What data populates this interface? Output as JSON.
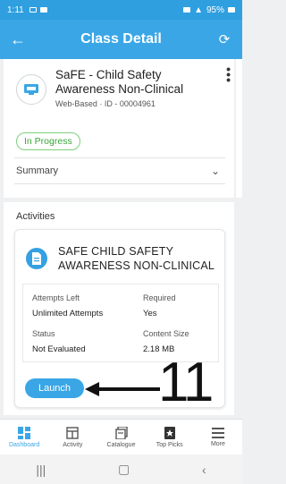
{
  "status_bar": {
    "time": "1:11",
    "battery": "95%"
  },
  "app_bar": {
    "title": "Class Detail"
  },
  "course": {
    "title": "SaFE - Child Safety Awareness Non-Clinical",
    "meta": "Web-Based · ID - 00004961",
    "status": "In Progress",
    "summary_label": "Summary"
  },
  "activities": {
    "label": "Activities",
    "item": {
      "title": "SAFE CHILD SAFETY AWARENESS NON-CLINICAL",
      "attempts_left_label": "Attempts Left",
      "attempts_left_value": "Unlimited Attempts",
      "required_label": "Required",
      "required_value": "Yes",
      "status_label": "Status",
      "status_value": "Not Evaluated",
      "content_size_label": "Content Size",
      "content_size_value": "2.18 MB",
      "launch_label": "Launch"
    }
  },
  "annotation": {
    "number": "11"
  },
  "bottom_nav": {
    "items": [
      {
        "label": "Dashboard",
        "icon": "dashboard-icon"
      },
      {
        "label": "Activity",
        "icon": "activity-icon"
      },
      {
        "label": "Catalogue",
        "icon": "catalogue-icon"
      },
      {
        "label": "Top Picks",
        "icon": "top-picks-icon"
      },
      {
        "label": "More",
        "icon": "more-menu-icon"
      }
    ]
  },
  "colors": {
    "primary": "#3aa6e6",
    "in_progress": "#3aa53a"
  }
}
